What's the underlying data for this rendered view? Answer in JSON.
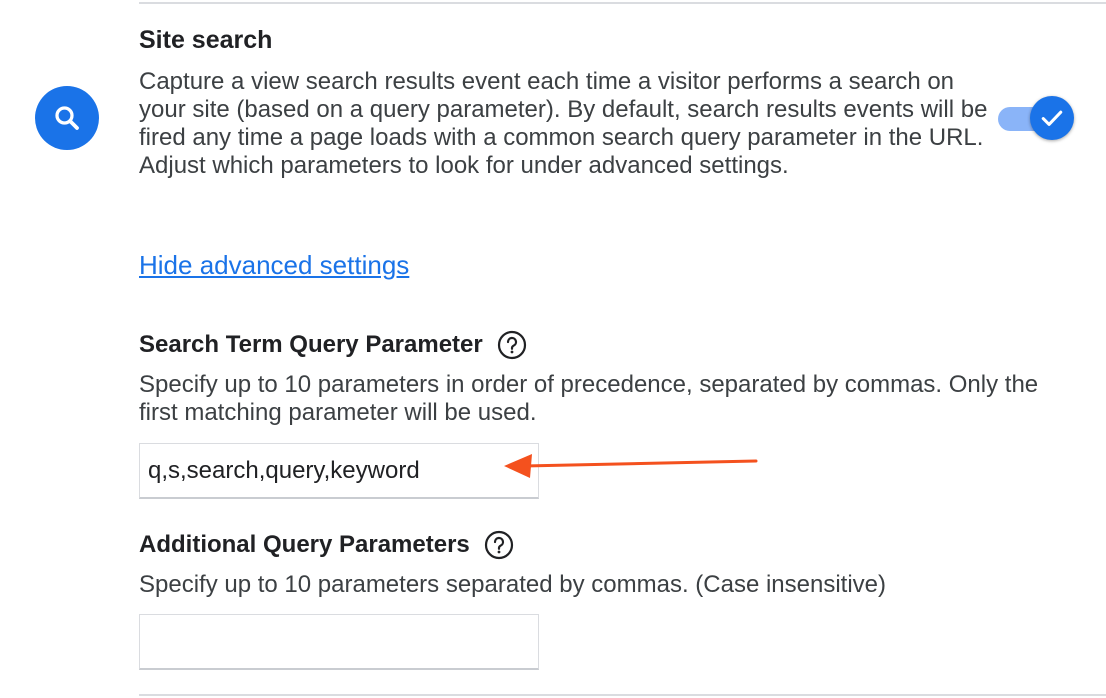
{
  "site_search": {
    "title": "Site search",
    "description": "Capture a view search results event each time a visitor performs a search on your site (based on a query parameter). By default, search results events will be fired any time a page loads with a common search query parameter in the URL. Adjust which parameters to look for under advanced settings.",
    "icon": "search-icon",
    "enabled": true,
    "toggle_icon": "check-icon"
  },
  "advanced_link": {
    "label": "Hide advanced settings"
  },
  "search_term_param": {
    "label": "Search Term Query Parameter",
    "help_icon": "help-circle-icon",
    "description": "Specify up to 10 parameters in order of precedence, separated by commas. Only the first matching parameter will be used.",
    "value": "q,s,search,query,keyword"
  },
  "additional_params": {
    "label": "Additional Query Parameters",
    "help_icon": "help-circle-icon",
    "description": "Specify up to 10 parameters separated by commas. (Case insensitive)",
    "value": ""
  },
  "annotation": {
    "arrow_color": "#f4511e",
    "icon": "arrow-left-icon"
  },
  "colors": {
    "accent": "#1a73e8",
    "toggle_track": "#8ab4f8",
    "divider": "#dadce0"
  }
}
